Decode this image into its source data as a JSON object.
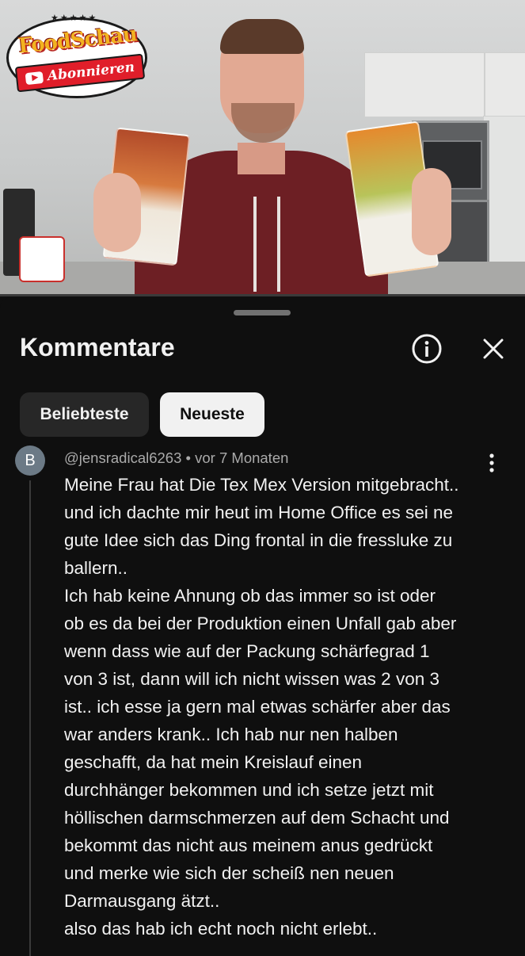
{
  "video": {
    "channel_logo": {
      "name": "FoodSchau",
      "subscribe_label": "Abonnieren",
      "stars": "★★★★★"
    },
    "progress": 0.0
  },
  "comments_panel": {
    "title": "Kommentare",
    "icons": {
      "info": "info-icon",
      "close": "close-icon"
    },
    "sort_chips": [
      {
        "label": "Beliebteste",
        "selected": false
      },
      {
        "label": "Neueste",
        "selected": true
      }
    ]
  },
  "comment": {
    "avatar_letter": "B",
    "author": "@jensradical6263",
    "separator": "•",
    "time": "vor 7 Monaten",
    "more_icon": "more-vertical-icon",
    "lines": [
      "Meine Frau hat Die Tex Mex Version mitgebracht..",
      "und ich dachte mir heut im Home Office es sei ne",
      "gute Idee sich das Ding frontal in die fressluke zu",
      "ballern..",
      "Ich hab keine Ahnung ob das immer so ist oder",
      "ob es da bei der Produktion einen Unfall gab aber",
      "wenn dass wie auf der Packung schärfegrad 1",
      "von 3 ist, dann will ich nicht wissen was 2 von 3",
      "ist.. ich esse ja gern mal etwas schärfer aber das",
      "war anders krank.. Ich hab nur nen halben",
      "geschafft, da hat mein Kreislauf einen",
      "durchhänger bekommen und ich setze jetzt mit",
      "höllischen darmschmerzen auf dem Schacht und",
      "bekommt das nicht aus meinem anus gedrückt",
      "und merke wie sich der scheiß nen neuen",
      "Darmausgang ätzt..",
      "also das hab ich echt noch nicht erlebt.."
    ]
  },
  "colors": {
    "background": "#0f0f0f",
    "chip_inactive": "#272727",
    "chip_active": "#f1f1f1",
    "meta_text": "#aaaaaa",
    "brand_red": "#e01e2a"
  }
}
